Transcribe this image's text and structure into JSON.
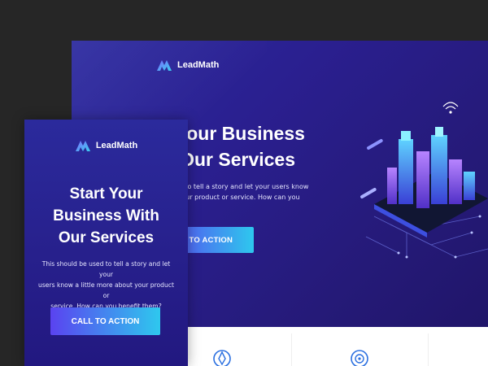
{
  "desktop": {
    "brand": "LeadMath",
    "hero_title_line1": "rt Your Business",
    "hero_title_line2": "th Our Services",
    "hero_text_line1": "be used to tell a story and let your users know",
    "hero_text_line2": "about your product or service. How can you",
    "hero_text_line3": "n?",
    "cta_label": "L TO ACTION"
  },
  "mobile": {
    "brand": "LeadMath",
    "hero_title_line1": "Start Your",
    "hero_title_line2": "Business With",
    "hero_title_line3": "Our Services",
    "hero_text_line1": "This should be used to tell a story and let your",
    "hero_text_line2": "users know a little more about your product or",
    "hero_text_line3": "service. How can you benefit them?",
    "cta_label": "CALL TO ACTION"
  },
  "colors": {
    "page_bg": "#262626",
    "hero_bg": "#2a1f8f",
    "cta_start": "#5a43f0",
    "cta_end": "#2ec8ee"
  },
  "icons": {
    "logo": "leadmath-logo-icon",
    "feature_1": "target-pin-icon",
    "feature_2": "radar-target-icon"
  }
}
